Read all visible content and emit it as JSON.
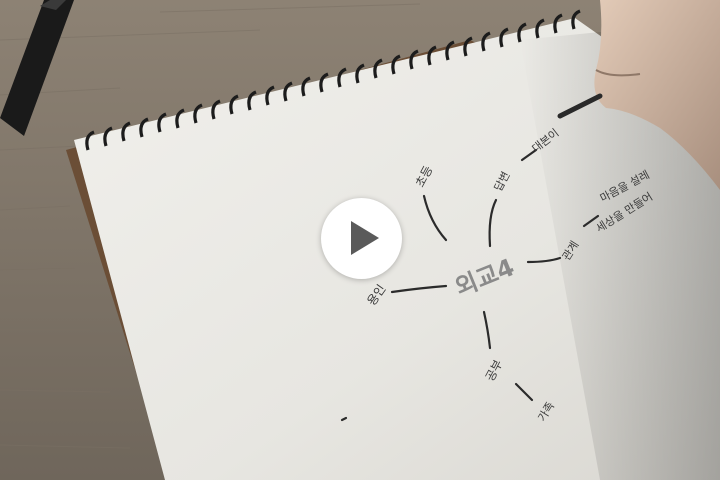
{
  "video": {
    "play_icon": "play-icon",
    "state": "paused"
  },
  "mindmap": {
    "center": "외교4",
    "words": {
      "top_left": "초등",
      "top_mid": "답변",
      "top_right": "대본이",
      "right_far": "마음을 설레",
      "right_mid": "세상을 만들어",
      "right": "관계",
      "left": "용인",
      "bottom": "공부",
      "bottom_far": "가족"
    }
  },
  "colors": {
    "desk": "#8b7f70",
    "paper": "#ecebe7",
    "ink": "#2b2b2b",
    "play_bg": "#ffffff",
    "play_glyph": "#5a5a5a"
  }
}
